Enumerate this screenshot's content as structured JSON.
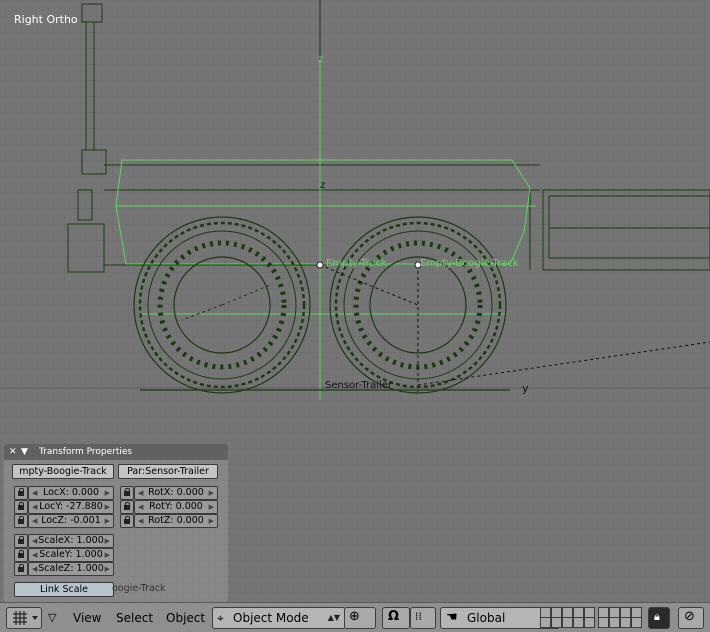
{
  "viewport": {
    "view_label": "Right Ortho",
    "axis_z1": "z",
    "axis_z2": "z",
    "axis_y": "y",
    "object_label_1": "Empty-Track",
    "object_label_2": "Empty-Boogie-Track",
    "object_label_3": "Sensor-Trailer"
  },
  "transform_panel": {
    "title": "Transform Properties",
    "object_name": "mpty-Boogie-Track",
    "parent": "Par:Sensor-Trailer",
    "loc_x": "LocX: 0.000",
    "loc_y": "LocY: -27.880",
    "loc_z": "LocZ: -0.001",
    "rot_x": "RotX: 0.000",
    "rot_y": "RotY: 0.000",
    "rot_z": "RotZ: 0.000",
    "scale_x": "ScaleX: 1.000",
    "scale_y": "ScaleY: 1.000",
    "scale_z": "ScaleZ: 1.000",
    "link_scale": "Link Scale",
    "name_ghost": "oogie-Track"
  },
  "header": {
    "menu_view": "View",
    "menu_select": "Select",
    "menu_object": "Object",
    "mode": "Object Mode",
    "orientation": "Global"
  },
  "colors": {
    "viewport_bg": "#757575",
    "wire_dark": "#1b3a12",
    "wire_selected": "#5fd35f",
    "grid": "#6a6a6a"
  }
}
